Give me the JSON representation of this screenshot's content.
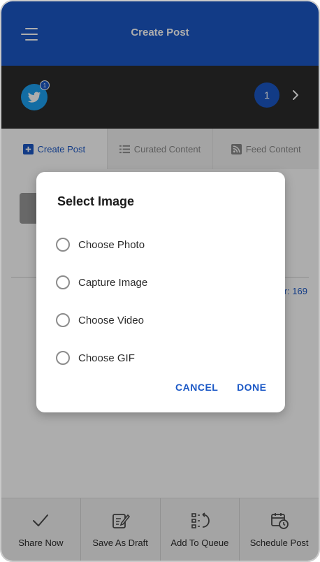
{
  "header": {
    "title": "Create Post"
  },
  "account": {
    "avatar_badge": "1",
    "count": "1"
  },
  "tabs": [
    {
      "label": "Create Post",
      "icon": "plus-square-icon",
      "active": true
    },
    {
      "label": "Curated Content",
      "icon": "list-icon",
      "active": false
    },
    {
      "label": "Feed Content",
      "icon": "rss-icon",
      "active": false
    }
  ],
  "editor": {
    "char_count_label": "r: 169"
  },
  "bottom_actions": [
    {
      "label": "Share Now",
      "icon": "check-icon"
    },
    {
      "label": "Save As Draft",
      "icon": "edit-note-icon"
    },
    {
      "label": "Add To Queue",
      "icon": "queue-icon"
    },
    {
      "label": "Schedule Post",
      "icon": "calendar-clock-icon"
    }
  ],
  "dialog": {
    "title": "Select Image",
    "options": [
      {
        "label": "Choose Photo"
      },
      {
        "label": "Capture Image"
      },
      {
        "label": "Choose Video"
      },
      {
        "label": "Choose GIF"
      }
    ],
    "cancel_label": "CANCEL",
    "done_label": "DONE"
  },
  "colors": {
    "primary": "#1b58c6",
    "account_bar": "#2b2b2b",
    "twitter": "#1da1f2"
  }
}
